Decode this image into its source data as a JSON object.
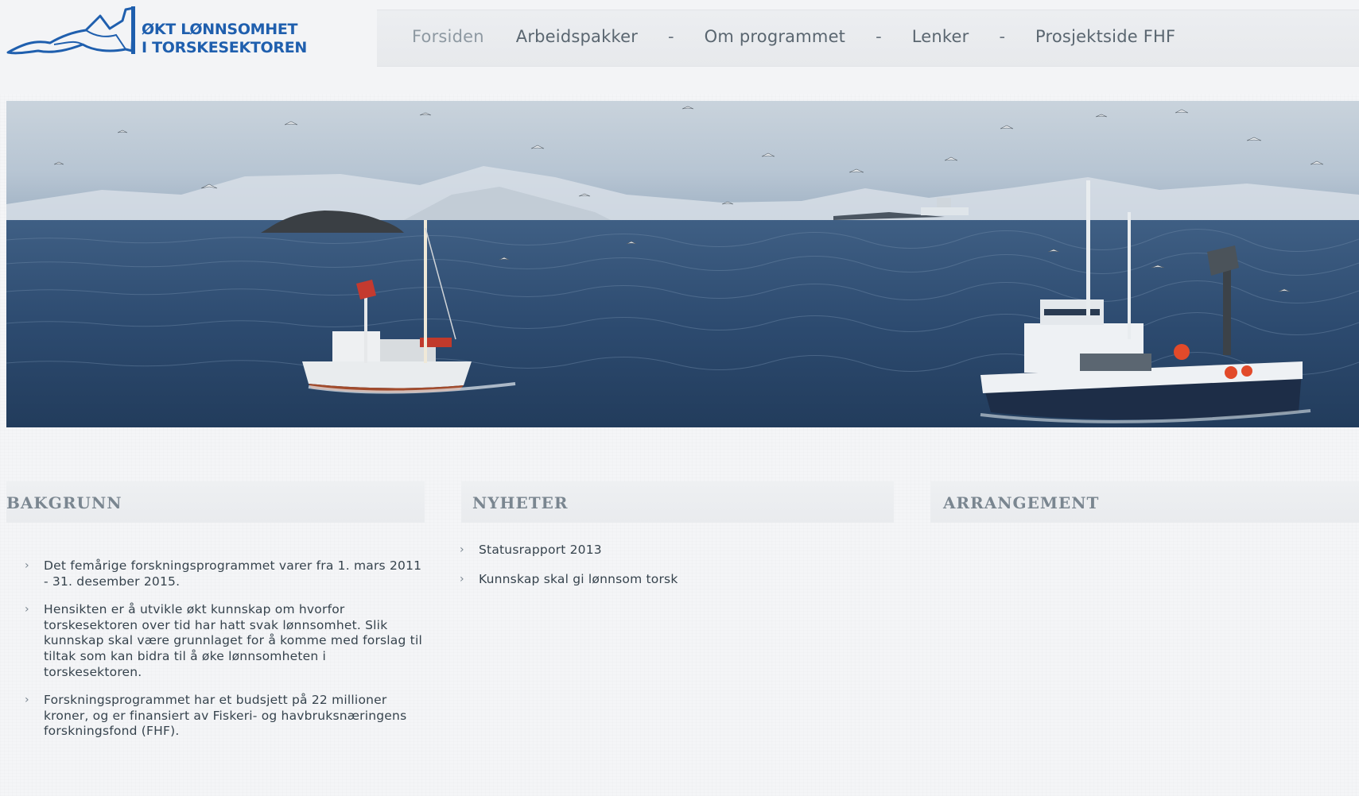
{
  "header": {
    "logo": {
      "line1": "ØKT LØNNSOMHET",
      "line2": "I TORSKESEKTOREN"
    },
    "nav": [
      {
        "label": "Forsiden"
      },
      {
        "label": "Arbeidspakker"
      },
      {
        "label": "Om programmet"
      },
      {
        "label": "Lenker"
      },
      {
        "label": "Prosjektside FHF"
      }
    ],
    "separator": "-"
  },
  "hero": {
    "icon": "fishing-boats-photo",
    "colors": {
      "sky": "#b9c8d6",
      "sea": "#2c4a6e",
      "hull_dark": "#1d2d47",
      "accent_red": "#d0402c"
    }
  },
  "columns": {
    "bakgrunn": {
      "title": "BAKGRUNN",
      "items": [
        {
          "text": "Det femårige forskningsprogrammet varer fra 1. mars 2011 - 31. desember 2015."
        },
        {
          "text": "Hensikten er å utvikle økt kunnskap om hvorfor torskesektoren over tid har hatt svak lønnsomhet. Slik kunnskap skal være grunnlaget for å komme med forslag til tiltak som kan bidra til å øke lønnsomheten i torskesektoren."
        },
        {
          "text": "Forskningsprogrammet har et budsjett på 22 millioner kroner, og er finansiert av Fiskeri- og havbruksnæringens forskningsfond (FHF)."
        }
      ]
    },
    "nyheter": {
      "title": "NYHETER",
      "items": [
        {
          "text": "Statusrapport 2013"
        },
        {
          "text": "Kunnskap skal gi lønnsom torsk"
        }
      ]
    },
    "arrangement": {
      "title": "ARRANGEMENT"
    }
  },
  "bullet_glyph": "›",
  "colors": {
    "brand_blue": "#1f5fae",
    "nav_text": "#5a6670",
    "heading": "#7a8690",
    "body_text": "#36434d"
  }
}
